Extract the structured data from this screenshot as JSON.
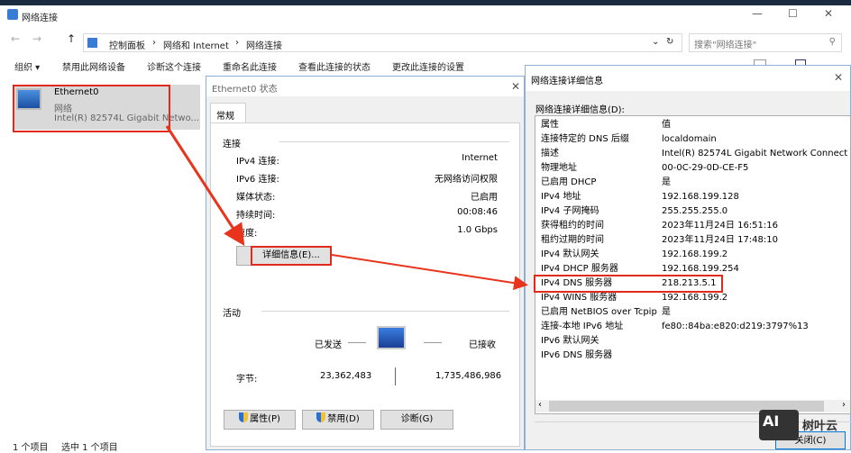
{
  "explorer": {
    "title": "网络连接",
    "breadcrumb": [
      "控制面板",
      "网络和 Internet",
      "网络连接"
    ],
    "search_placeholder": "搜索\"网络连接\"",
    "toolbar": [
      "组织 ▾",
      "禁用此网络设备",
      "诊断这个连接",
      "重命名此连接",
      "查看此连接的状态",
      "更改此连接的设置"
    ],
    "item": {
      "name": "Ethernet0",
      "type": "网络",
      "adapter": "Intel(R) 82574L Gigabit Netwo..."
    },
    "status": {
      "count": "1 个项目",
      "selected": "选中 1 个项目"
    }
  },
  "status_dialog": {
    "title": "Ethernet0 状态",
    "tab": "常规",
    "connection_heading": "连接",
    "rows": [
      {
        "label": "IPv4 连接:",
        "value": "Internet"
      },
      {
        "label": "IPv6 连接:",
        "value": "无网络访问权限"
      },
      {
        "label": "媒体状态:",
        "value": "已启用"
      },
      {
        "label": "持续时间:",
        "value": "00:08:46"
      },
      {
        "label": "速度:",
        "value": "1.0 Gbps"
      }
    ],
    "details_button": "详细信息(E)...",
    "activity_heading": "活动",
    "sent_label": "已发送",
    "received_label": "已接收",
    "bytes_label": "字节:",
    "bytes_sent": "23,362,483",
    "bytes_received": "1,735,486,986",
    "buttons": [
      "属性(P)",
      "禁用(D)",
      "诊断(G)"
    ]
  },
  "details_dialog": {
    "title": "网络连接详细信息",
    "list_label": "网络连接详细信息(D):",
    "col_property": "属性",
    "col_value": "值",
    "rows": [
      [
        "连接特定的 DNS 后缀",
        "localdomain"
      ],
      [
        "描述",
        "Intel(R) 82574L Gigabit Network Connect"
      ],
      [
        "物理地址",
        "00-0C-29-0D-CE-F5"
      ],
      [
        "已启用 DHCP",
        "是"
      ],
      [
        "IPv4 地址",
        "192.168.199.128"
      ],
      [
        "IPv4 子网掩码",
        "255.255.255.0"
      ],
      [
        "获得租约的时间",
        "2023年11月24日 16:51:16"
      ],
      [
        "租约过期的时间",
        "2023年11月24日 17:48:10"
      ],
      [
        "IPv4 默认网关",
        "192.168.199.2"
      ],
      [
        "IPv4 DHCP 服务器",
        "192.168.199.254"
      ],
      [
        "IPv4 DNS 服务器",
        "218.213.5.1"
      ],
      [
        "IPv4 WINS 服务器",
        "192.168.199.2"
      ],
      [
        "已启用 NetBIOS over Tcpip",
        "是"
      ],
      [
        "连接-本地 IPv6 地址",
        "fe80::84ba:e820:d219:3797%13"
      ],
      [
        "IPv6 默认网关",
        ""
      ],
      [
        "IPv6 DNS 服务器",
        ""
      ]
    ],
    "close_button": "关闭(C)"
  },
  "watermark": {
    "logo": "AI",
    "text": "树叶云"
  }
}
